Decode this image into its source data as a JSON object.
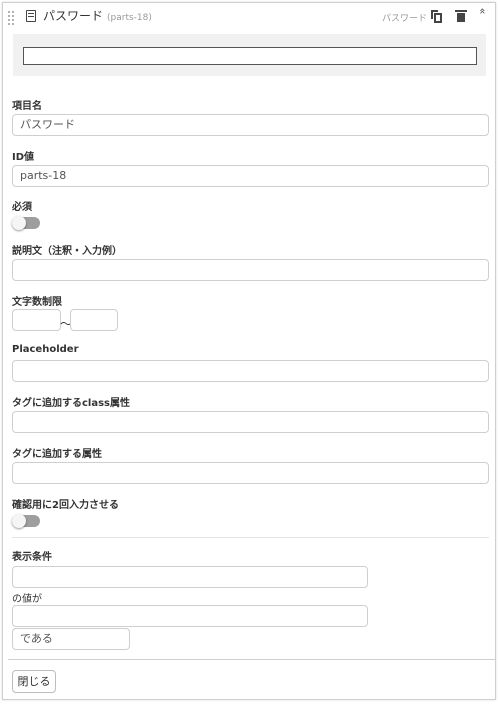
{
  "header": {
    "title": "パスワード",
    "field_id": "(parts-18)",
    "type_label": "パスワード",
    "icons": [
      "drag-handle-icon",
      "text-field-icon",
      "copy-icon",
      "trash-icon",
      "collapse-icon"
    ],
    "collapse_glyph": "»"
  },
  "form": {
    "item_name": {
      "label": "項目名",
      "value": "パスワード"
    },
    "id_value": {
      "label": "ID値",
      "value": "parts-18"
    },
    "required": {
      "label": "必須",
      "on": false
    },
    "description": {
      "label": "説明文（注釈・入力例）",
      "value": ""
    },
    "char_limit": {
      "label": "文字数制限",
      "min": "",
      "max": "",
      "separator": "～"
    },
    "placeholder": {
      "label": "Placeholder",
      "value": ""
    },
    "class_attr": {
      "label": "タグに追加するclass属性",
      "value": ""
    },
    "tag_attr": {
      "label": "タグに追加する属性",
      "value": ""
    },
    "confirm_twice": {
      "label": "確認用に2回入力させる",
      "on": false
    }
  },
  "display_condition": {
    "label": "表示条件",
    "field": "",
    "value_label": "の値が",
    "value": "",
    "operator": "である"
  },
  "footer": {
    "close_label": "閉じる"
  },
  "colors": {
    "toggle_off": "#9e9e9e",
    "border": "#cfcfcf",
    "preview_bg": "#f1f1f1"
  }
}
